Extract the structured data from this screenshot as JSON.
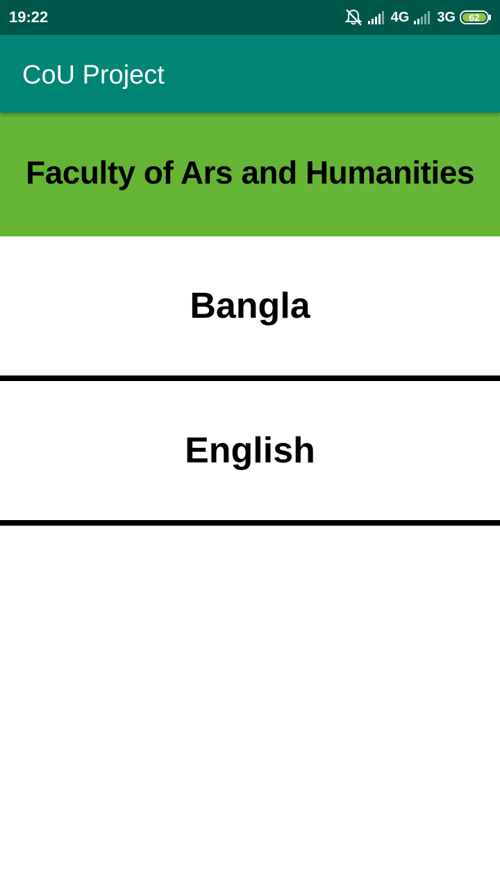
{
  "status_bar": {
    "time": "19:22",
    "icons": [
      "alarm-off-icon",
      "signal-icon",
      "signal-icon"
    ],
    "network_1": "4G",
    "network_2": "3G",
    "battery": "62",
    "battery_color": "#8bc34a"
  },
  "app_bar": {
    "title": "CoU Project",
    "color": "#008577"
  },
  "faculty": {
    "title": "Faculty of Ars and Humanities",
    "color": "#65b536"
  },
  "departments": [
    {
      "label": "Bangla"
    },
    {
      "label": "English"
    }
  ]
}
